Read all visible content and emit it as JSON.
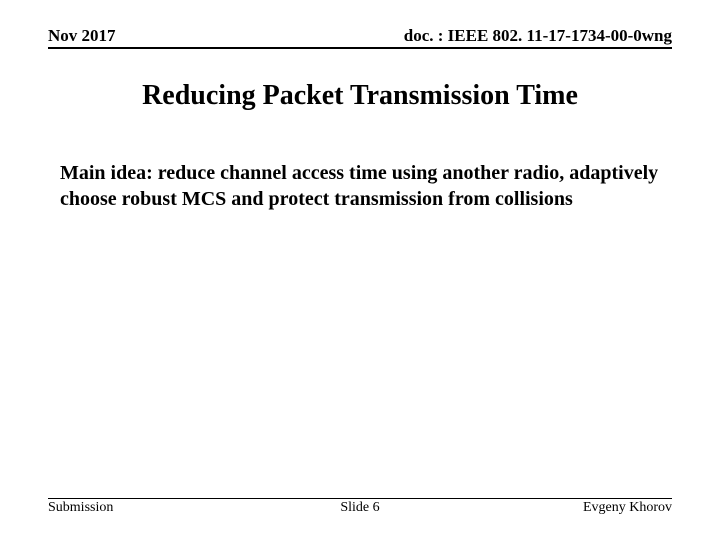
{
  "header": {
    "date": "Nov 2017",
    "doc": "doc. : IEEE 802. 11-17-1734-00-0wng"
  },
  "title": "Reducing Packet Transmission Time",
  "body": "Main idea: reduce channel access time using another radio, adaptively choose robust MCS and protect transmission from collisions",
  "footer": {
    "left": "Submission",
    "center": "Slide 6",
    "right": "Evgeny Khorov"
  }
}
